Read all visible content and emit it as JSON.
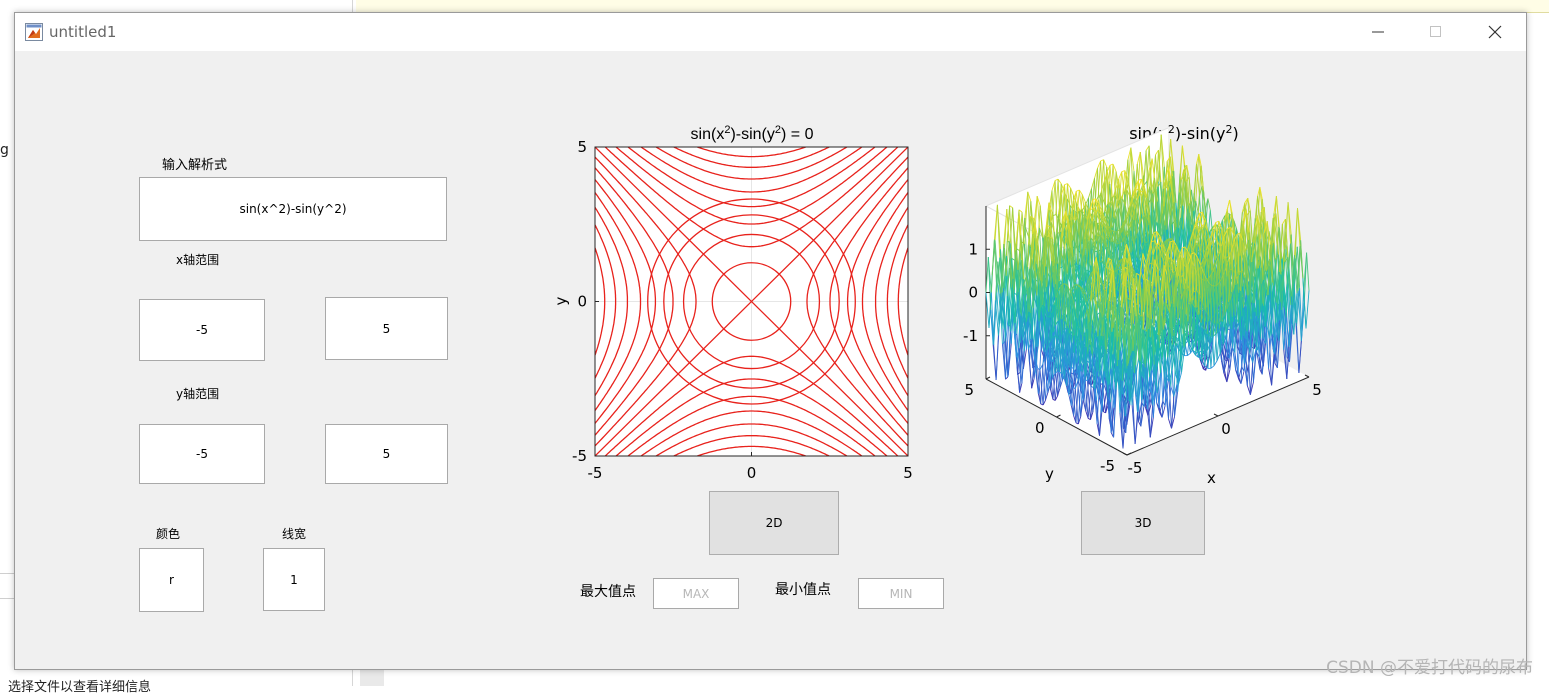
{
  "window": {
    "title": "untitled1"
  },
  "form": {
    "expr_label": "输入解析式",
    "expr_value": "sin(x^2)-sin(y^2)",
    "x_label": "x轴范围",
    "x_min": "-5",
    "x_max": "5",
    "y_label": "y轴范围",
    "y_min": "-5",
    "y_max": "5",
    "color_label": "颜色",
    "color_value": "r",
    "width_label": "线宽",
    "width_value": "1"
  },
  "buttons": {
    "plot2d": "2D",
    "plot3d": "3D"
  },
  "extrema": {
    "max_label": "最大值点",
    "max_value": "MAX",
    "min_label": "最小值点",
    "min_value": "MIN"
  },
  "background": {
    "left_char": "g",
    "bottom_text": "选择文件以查看详细信息"
  },
  "watermark": "CSDN @不爱打代码的尿布",
  "chart_data": [
    {
      "type": "line",
      "title": "sin(x²)-sin(y²) = 0",
      "title_parts": [
        "sin(x",
        "2",
        ")-sin(y",
        "2",
        ") = 0"
      ],
      "xlabel": "",
      "ylabel": "y",
      "xlim": [
        -5,
        5
      ],
      "ylim": [
        -5,
        5
      ],
      "xticks": [
        "-5",
        "0",
        "5"
      ],
      "yticks": [
        "-5",
        "0",
        "5"
      ],
      "grid": true,
      "color": "#e8221c",
      "function": "sin(x^2)-sin(y^2)=0",
      "circle_radii_k": [
        1,
        3,
        5,
        7
      ],
      "hyperbola_k": [
        1,
        2,
        3,
        4,
        5,
        6,
        7
      ],
      "diagonals": true
    },
    {
      "type": "surface",
      "title": "sin(x²)-sin(y²)",
      "title_parts": [
        "sin(x",
        "2",
        ")-sin(y",
        "2",
        ")"
      ],
      "xlabel": "x",
      "ylabel": "y",
      "xlim": [
        -5,
        5
      ],
      "ylim": [
        -5,
        5
      ],
      "zlim": [
        -2,
        2
      ],
      "xticks": [
        "-5",
        "0",
        "5"
      ],
      "yticks": [
        "-5",
        "0",
        "5"
      ],
      "zticks": [
        "1",
        "0",
        "-1"
      ],
      "colormap": [
        "#3e26a8",
        "#2f8ce5",
        "#17c0a9",
        "#8ecc45",
        "#f9e52a"
      ]
    }
  ]
}
